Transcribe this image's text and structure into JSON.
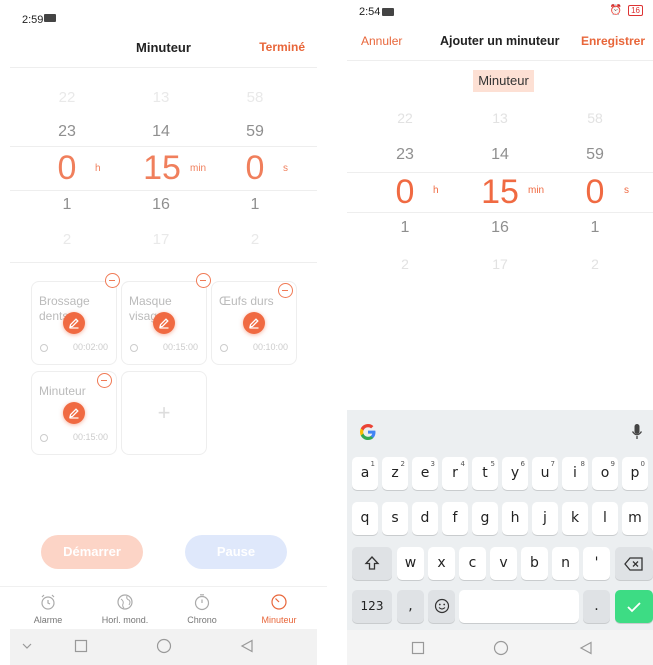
{
  "left": {
    "status": {
      "time": "2:59",
      "battery": "19"
    },
    "header": {
      "title": "Minuteur",
      "done_label": "Terminé"
    },
    "picker": {
      "hours": [
        "22",
        "23",
        "0",
        "1",
        "2"
      ],
      "minutes": [
        "13",
        "14",
        "15",
        "16",
        "17"
      ],
      "seconds": [
        "58",
        "59",
        "0",
        "1",
        "2"
      ],
      "hours_unit": "h",
      "minutes_unit": "min",
      "seconds_unit": "s"
    },
    "presets": [
      {
        "name": "Brossage dents",
        "duration": "00:02:00"
      },
      {
        "name": "Masque visage",
        "duration": "00:15:00"
      },
      {
        "name": "Œufs durs",
        "duration": "00:10:00"
      },
      {
        "name": "Minuteur",
        "duration": "00:15:00"
      }
    ],
    "add_symbol": "+",
    "buttons": {
      "start": "Démarrer",
      "pause": "Pause"
    },
    "tabs": [
      {
        "label": "Alarme",
        "icon": "alarm-clock-icon"
      },
      {
        "label": "Horl. mond.",
        "icon": "globe-icon"
      },
      {
        "label": "Chrono",
        "icon": "stopwatch-icon"
      },
      {
        "label": "Minuteur",
        "icon": "timer-icon"
      }
    ],
    "active_tab": "Minuteur"
  },
  "right": {
    "status": {
      "time": "2:54",
      "battery": "16"
    },
    "header": {
      "cancel": "Annuler",
      "title": "Ajouter un minuteur",
      "save": "Enregistrer"
    },
    "name_field": "Minuteur",
    "picker": {
      "hours": [
        "22",
        "23",
        "0",
        "1",
        "2"
      ],
      "minutes": [
        "13",
        "14",
        "15",
        "16",
        "17"
      ],
      "seconds": [
        "58",
        "59",
        "0",
        "1",
        "2"
      ],
      "hours_unit": "h",
      "minutes_unit": "min",
      "seconds_unit": "s"
    },
    "keyboard": {
      "row1": [
        "a",
        "z",
        "e",
        "r",
        "t",
        "y",
        "u",
        "i",
        "o",
        "p"
      ],
      "row1_hints": [
        "1",
        "2",
        "3",
        "4",
        "5",
        "6",
        "7",
        "8",
        "9",
        "0"
      ],
      "row2": [
        "q",
        "s",
        "d",
        "f",
        "g",
        "h",
        "j",
        "k",
        "l",
        "m"
      ],
      "row3": [
        "w",
        "x",
        "c",
        "v",
        "b",
        "n",
        "'"
      ],
      "numbers_key": "123",
      "comma": ",",
      "period": "."
    }
  },
  "colors": {
    "accent": "#e8663a",
    "edit": "#f06a42",
    "enter": "#3ddc84",
    "pause": "#dfe8fb",
    "start": "#fcd4c6"
  }
}
